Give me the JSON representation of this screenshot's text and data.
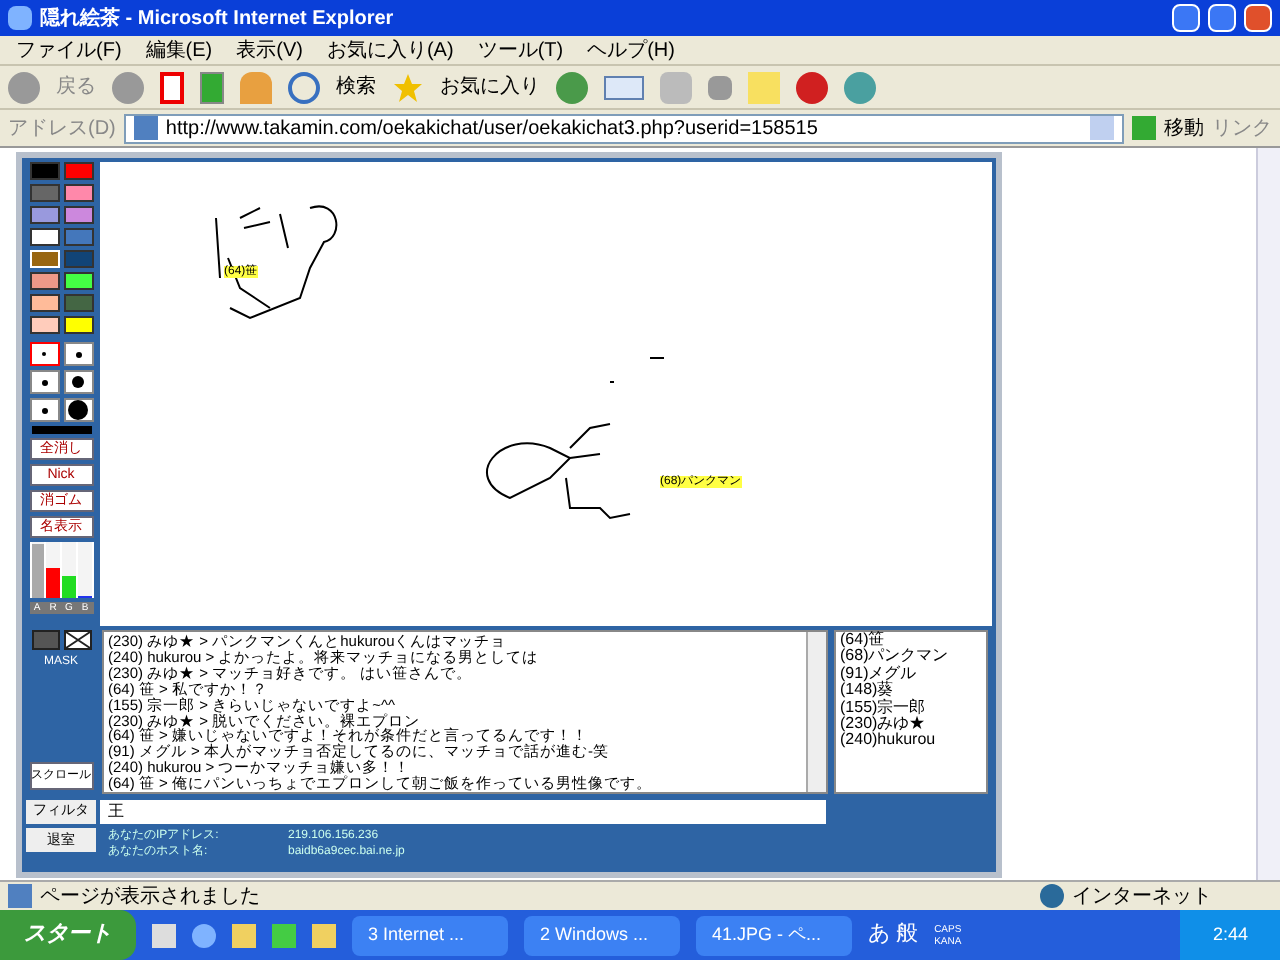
{
  "window": {
    "title": "隠れ絵茶 - Microsoft Internet Explorer"
  },
  "menu": [
    "ファイル(F)",
    "編集(E)",
    "表示(V)",
    "お気に入り(A)",
    "ツール(T)",
    "ヘルプ(H)"
  ],
  "toolbar": {
    "back": "戻る",
    "search": "検索",
    "favorites": "お気に入り"
  },
  "address": {
    "label": "アドレス(D)",
    "url": "http://www.takamin.com/oekakichat/user/oekakichat3.php?userid=158515",
    "go": "移動",
    "links": "リンク"
  },
  "palette": [
    {
      "color": "#000000",
      "selected": false
    },
    {
      "color": "#ff0000",
      "selected": false
    },
    {
      "color": "#666666",
      "selected": false
    },
    {
      "color": "#ff88aa",
      "selected": false
    },
    {
      "color": "#9999dd",
      "selected": false
    },
    {
      "color": "#cc88dd",
      "selected": false
    },
    {
      "color": "#ffffff",
      "selected": false
    },
    {
      "color": "#4477bb",
      "selected": false
    },
    {
      "color": "#996611",
      "selected": true
    },
    {
      "color": "#114477",
      "selected": false
    },
    {
      "color": "#ee9988",
      "selected": false
    },
    {
      "color": "#44ff44",
      "selected": false
    },
    {
      "color": "#ffbb99",
      "selected": false
    },
    {
      "color": "#446644",
      "selected": false
    },
    {
      "color": "#ffccbb",
      "selected": false
    },
    {
      "color": "#ffff00",
      "selected": false
    }
  ],
  "pens": [
    {
      "selected": true
    },
    {
      "selected": false
    },
    {
      "selected": false
    },
    {
      "selected": false
    },
    {
      "selected": false
    },
    {
      "selected": false
    }
  ],
  "tools": [
    "全消し",
    "Nick",
    "消ゴム",
    "名表示"
  ],
  "sliders": [
    {
      "label": "A",
      "level": 0.95
    },
    {
      "label": "R",
      "level": 0.55
    },
    {
      "label": "G",
      "level": 0.4
    },
    {
      "label": "B",
      "level": 0.05
    }
  ],
  "mask_label": "MASK",
  "scroll_button": "スクロール",
  "canvas_labels": [
    "(64)笹",
    "(68)パンクマン"
  ],
  "chat": [
    "(230) みゆ★ > パンクマンくんとhukurouくんはマッチョ",
    "(240) hukurou > よかったよ。将来マッチョになる男としては",
    "(230) みゆ★ > マッチョ好きです。 はい笹さんで。",
    "(64) 笹 > 私ですか！？",
    "(155) 宗一郎 > きらいじゃないですよ~^^",
    "(230) みゆ★ > 脱いでください。裸エプロン",
    "(64) 笹 > 嫌いじゃないですよ！それが条件だと言ってるんです！！",
    "(91) メグル > 本人がマッチョ否定してるのに、マッチョで話が進む-笑",
    "(240) hukurou > つーかマッチョ嫌い多！！",
    "(64) 笹 > 俺にパンいっちょでエプロンして朝ご飯を作っている男性像です。"
  ],
  "users": [
    "(64)笹",
    "(68)パンクマン",
    "(91)メグル",
    "(148)葵",
    "(155)宗一郎",
    "(230)みゆ★",
    "(240)hukurou"
  ],
  "filter": {
    "button": "フィルタ",
    "value": "王"
  },
  "exit_button": "退室",
  "info": [
    {
      "label": "あなたのIPアドレス:",
      "value": "219.106.156.236"
    },
    {
      "label": "あなたのホスト名:",
      "value": "baidb6a9cec.bai.ne.jp"
    }
  ],
  "status_bar": {
    "message": "ページが表示されました",
    "zone": "インターネット"
  },
  "taskbar": {
    "start": "スタート",
    "tasks": [
      "3 Internet ...",
      "2 Windows ...",
      "41.JPG - ペ..."
    ],
    "ime": "あ 般",
    "caps": "CAPS",
    "kana": "KANA",
    "clock": "2:44"
  }
}
